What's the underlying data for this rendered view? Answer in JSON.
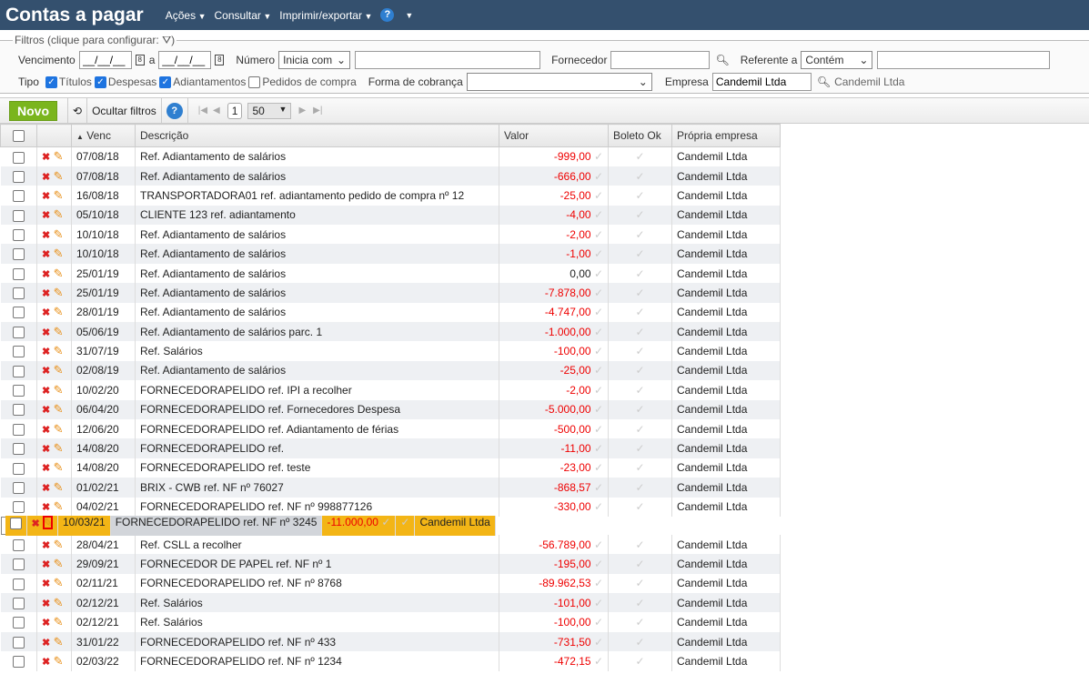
{
  "header": {
    "title": "Contas a pagar",
    "menus": [
      "Ações",
      "Consultar",
      "Imprimir/exportar"
    ]
  },
  "filters": {
    "legend": "Filtros (clique para configurar:",
    "legend_end": ")",
    "vencimento": "Vencimento",
    "date_placeholder": "__/__/__",
    "a": "a",
    "numero": "Número",
    "numero_op": "Inicia com",
    "fornecedor": "Fornecedor",
    "referente": "Referente a",
    "referente_op": "Contém",
    "tipo": "Tipo",
    "tipos": [
      {
        "label": "Títulos",
        "checked": true
      },
      {
        "label": "Despesas",
        "checked": true
      },
      {
        "label": "Adiantamentos",
        "checked": true
      },
      {
        "label": "Pedidos de compra",
        "checked": false
      }
    ],
    "forma": "Forma de cobrança",
    "empresa": "Empresa",
    "empresa_value": "Candemil Ltda",
    "empresa_name": "Candemil Ltda"
  },
  "toolbar": {
    "novo": "Novo",
    "ocultar": "Ocultar filtros",
    "page": "1",
    "page_size": "50"
  },
  "table": {
    "headers": [
      "Venc",
      "Descrição",
      "Valor",
      "Boleto Ok",
      "Própria empresa"
    ],
    "rows": [
      [
        "07/08/18",
        "Ref. Adiantamento de salários",
        "-999,00",
        "Candemil Ltda"
      ],
      [
        "07/08/18",
        "Ref. Adiantamento de salários",
        "-666,00",
        "Candemil Ltda"
      ],
      [
        "16/08/18",
        "TRANSPORTADORA01 ref. adiantamento pedido de compra nº 12",
        "-25,00",
        "Candemil Ltda"
      ],
      [
        "05/10/18",
        "CLIENTE 123 ref. adiantamento",
        "-4,00",
        "Candemil Ltda"
      ],
      [
        "10/10/18",
        "Ref. Adiantamento de salários",
        "-2,00",
        "Candemil Ltda"
      ],
      [
        "10/10/18",
        "Ref. Adiantamento de salários",
        "-1,00",
        "Candemil Ltda"
      ],
      [
        "25/01/19",
        "Ref. Adiantamento de salários",
        "0,00",
        "Candemil Ltda"
      ],
      [
        "25/01/19",
        "Ref. Adiantamento de salários",
        "-7.878,00",
        "Candemil Ltda"
      ],
      [
        "28/01/19",
        "Ref. Adiantamento de salários",
        "-4.747,00",
        "Candemil Ltda"
      ],
      [
        "05/06/19",
        "Ref. Adiantamento de salários parc. 1",
        "-1.000,00",
        "Candemil Ltda"
      ],
      [
        "31/07/19",
        "Ref. Salários",
        "-100,00",
        "Candemil Ltda"
      ],
      [
        "02/08/19",
        "Ref. Adiantamento de salários",
        "-25,00",
        "Candemil Ltda"
      ],
      [
        "10/02/20",
        "FORNECEDORAPELIDO ref. IPI a recolher",
        "-2,00",
        "Candemil Ltda"
      ],
      [
        "06/04/20",
        "FORNECEDORAPELIDO ref. Fornecedores Despesa",
        "-5.000,00",
        "Candemil Ltda"
      ],
      [
        "12/06/20",
        "FORNECEDORAPELIDO ref. Adiantamento de férias",
        "-500,00",
        "Candemil Ltda"
      ],
      [
        "14/08/20",
        "FORNECEDORAPELIDO ref.",
        "-11,00",
        "Candemil Ltda"
      ],
      [
        "14/08/20",
        "FORNECEDORAPELIDO ref. teste",
        "-23,00",
        "Candemil Ltda"
      ],
      [
        "01/02/21",
        "BRIX - CWB ref. NF nº 76027",
        "-868,57",
        "Candemil Ltda"
      ],
      [
        "04/02/21",
        "FORNECEDORAPELIDO ref. NF nº 998877126",
        "-330,00",
        "Candemil Ltda"
      ],
      [
        "10/03/21",
        "FORNECEDORAPELIDO ref. NF nº 3245",
        "-11.000,00",
        "Candemil Ltda"
      ],
      [
        "28/04/21",
        "Ref. CSLL a recolher",
        "-56.789,00",
        "Candemil Ltda"
      ],
      [
        "29/09/21",
        "FORNECEDOR DE PAPEL ref. NF nº 1",
        "-195,00",
        "Candemil Ltda"
      ],
      [
        "02/11/21",
        "FORNECEDORAPELIDO ref. NF nº 8768",
        "-89.962,53",
        "Candemil Ltda"
      ],
      [
        "02/12/21",
        "Ref. Salários",
        "-101,00",
        "Candemil Ltda"
      ],
      [
        "02/12/21",
        "Ref. Salários",
        "-100,00",
        "Candemil Ltda"
      ],
      [
        "31/01/22",
        "FORNECEDORAPELIDO ref. NF nº 433",
        "-731,50",
        "Candemil Ltda"
      ],
      [
        "02/03/22",
        "FORNECEDORAPELIDO ref. NF nº 1234",
        "-472,15",
        "Candemil Ltda"
      ]
    ],
    "selected_row": 19
  },
  "colors": {
    "header": "#34506e",
    "selected": "#f3b516",
    "novo": "#7ab51d"
  }
}
